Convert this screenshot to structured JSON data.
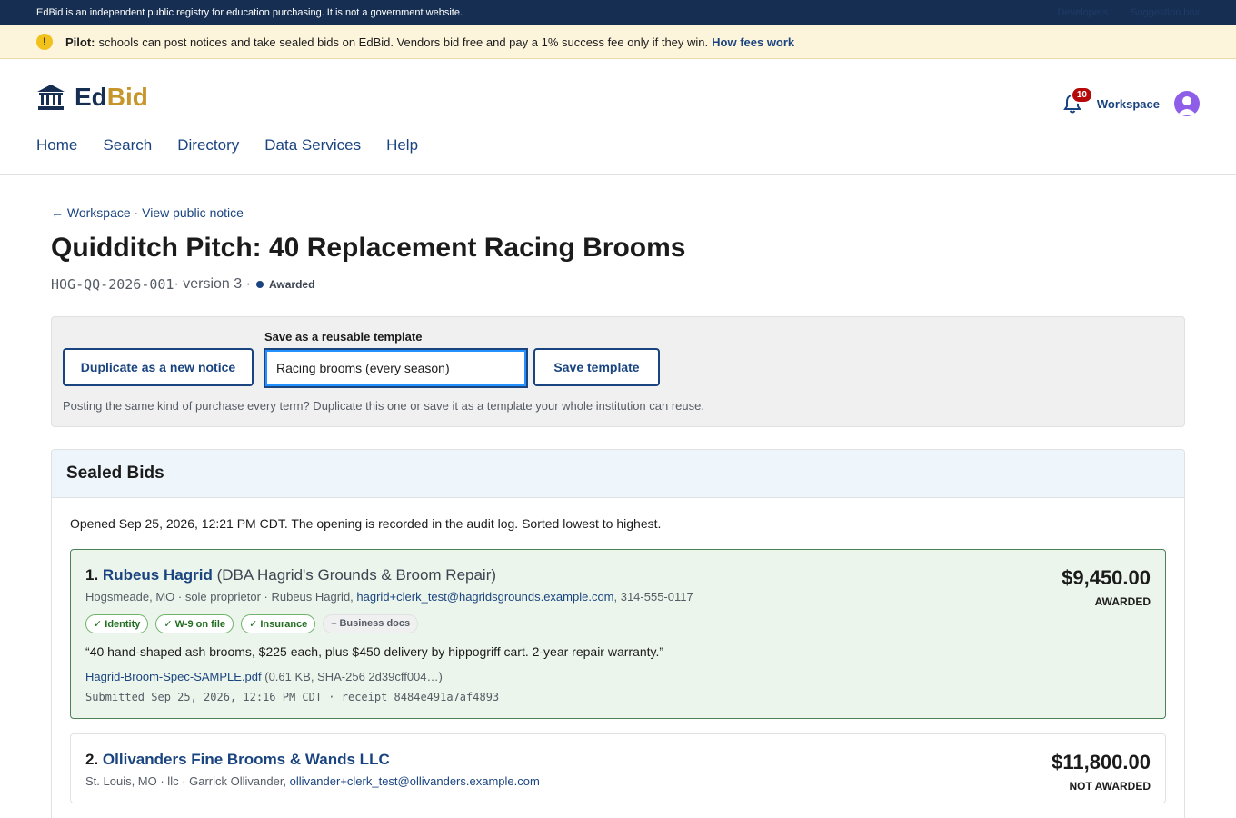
{
  "topbar": {
    "disclaimer": "EdBid is an independent public registry for education purchasing. It is not a government website.",
    "link1": "Developers",
    "link2": "Suggestion box"
  },
  "pilot": {
    "label": "Pilot:",
    "text": "schools can post notices and take sealed bids on EdBid. Vendors bid free and pay a 1% success fee only if they win.",
    "link": "How fees work"
  },
  "header": {
    "brand_ed": "Ed",
    "brand_bid": "Bid",
    "nav": [
      "Home",
      "Search",
      "Directory",
      "Data Services",
      "Help"
    ],
    "notif_count": "10",
    "workspace": "Workspace"
  },
  "crumb": {
    "back": "← Workspace",
    "sep": " · ",
    "view": "View public notice"
  },
  "notice": {
    "title": "Quidditch Pitch: 40 Replacement Racing Brooms",
    "code": "HOG-QQ-2026-001",
    "version": " · version 3 · ",
    "status": "Awarded"
  },
  "template": {
    "duplicate": "Duplicate as a new notice",
    "label": "Save as a reusable template",
    "value": "Racing brooms (every season)",
    "save": "Save template",
    "hint": "Posting the same kind of purchase every term? Duplicate this one or save it as a template your whole institution can reuse."
  },
  "bids": {
    "heading": "Sealed Bids",
    "opened": "Opened Sep 25, 2026, 12:21 PM CDT. The opening is recorded in the audit log. Sorted lowest to highest.",
    "items": [
      {
        "num": "1.",
        "vendor": "Rubeus Hagrid",
        "dba": "(DBA Hagrid's Grounds & Broom Repair)",
        "line": "Hogsmeade, MO · sole proprietor · Rubeus Hagrid, ",
        "email": "hagrid+clerk_test@hagridsgrounds.example.com",
        "phone": ", 314-555-0117",
        "chips": [
          "✓ Identity",
          "✓ W-9 on file",
          "✓ Insurance",
          "– Business docs"
        ],
        "quote": "“40 hand-shaped ash brooms, $225 each, plus $450 delivery by hippogriff cart. 2-year repair warranty.”",
        "file": "Hagrid-Broom-Spec-SAMPLE.pdf",
        "file_meta": " (0.61 KB, SHA-256 2d39cff004…)",
        "receipt": "Submitted Sep 25, 2026, 12:16 PM CDT · receipt 8484e491a7af4893",
        "amount": "$9,450.00",
        "status": "AWARDED"
      },
      {
        "num": "2.",
        "vendor": "Ollivanders Fine Brooms & Wands LLC",
        "line": "St. Louis, MO · llc · Garrick Ollivander, ",
        "email": "ollivander+clerk_test@ollivanders.example.com",
        "amount": "$11,800.00",
        "status": "NOT AWARDED"
      }
    ]
  },
  "colors": {
    "navy": "#162e51",
    "link": "#1a4480",
    "gold": "#c6962a",
    "awarded_bg": "#ecf5eb",
    "badge_red": "#b50909"
  }
}
